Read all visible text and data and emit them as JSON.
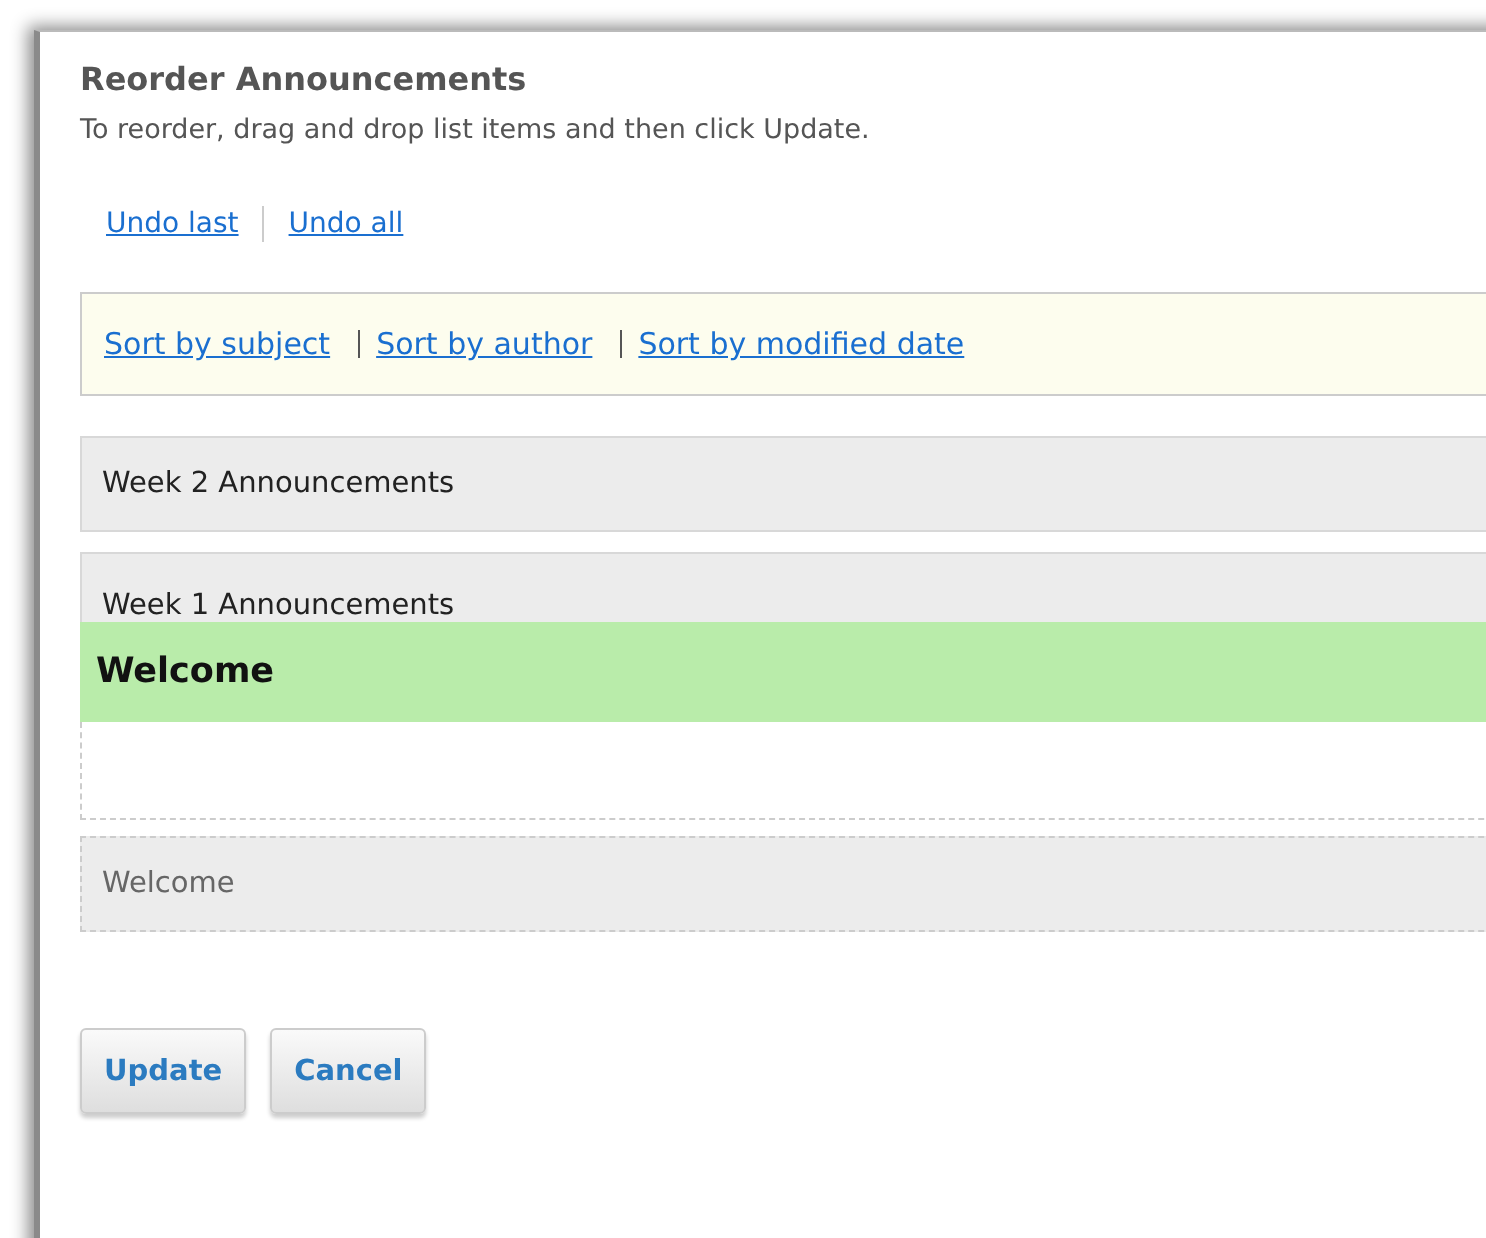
{
  "title": "Reorder Announcements",
  "instructions": "To reorder, drag and drop list items and then click Update.",
  "undo_links": [
    "Undo last",
    "Undo all"
  ],
  "sort_links": [
    "Sort by subject",
    "Sort by author",
    "Sort by modified date"
  ],
  "items": [
    {
      "kind": "item",
      "label": "Week 2 Announcements"
    },
    {
      "kind": "covered",
      "label": "Week 1 Announcements"
    },
    {
      "kind": "dragging",
      "label": "Welcome"
    },
    {
      "kind": "placeholder"
    },
    {
      "kind": "ghost",
      "label": "Welcome"
    }
  ],
  "buttons": [
    "Update",
    "Cancel"
  ]
}
